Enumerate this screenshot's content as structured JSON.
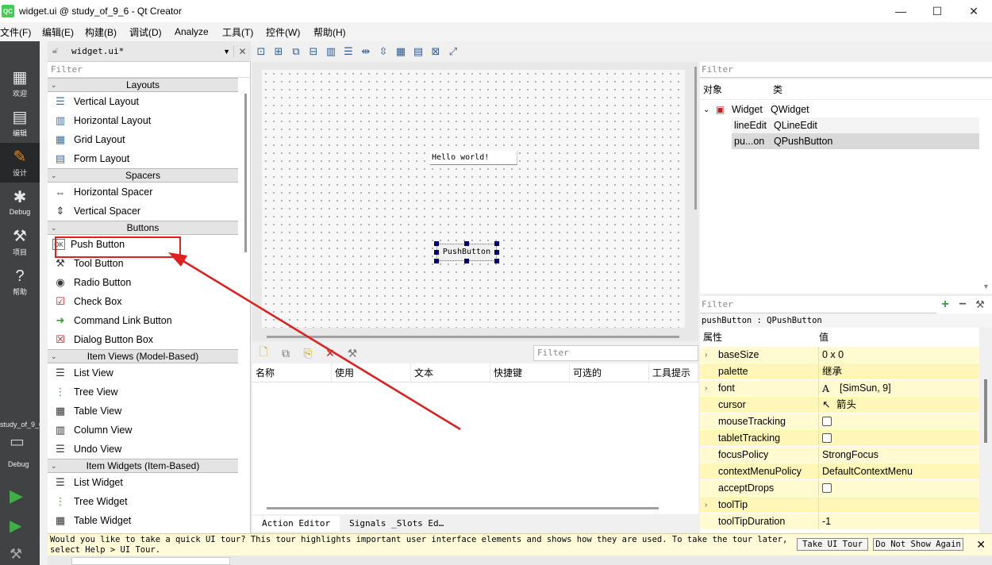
{
  "window": {
    "title": "widget.ui @ study_of_9_6 - Qt Creator",
    "app_icon_text": "QC",
    "controls": [
      "—",
      "☐",
      "✕"
    ]
  },
  "menubar": [
    "文件(F)",
    "编辑(E)",
    "构建(B)",
    "调试(D)",
    "Analyze",
    "工具(T)",
    "控件(W)",
    "帮助(H)"
  ],
  "modes": [
    {
      "label": "欢迎",
      "icon": "grid-icon"
    },
    {
      "label": "编辑",
      "icon": "document-icon"
    },
    {
      "label": "设计",
      "icon": "pencil-icon"
    },
    {
      "label": "Debug",
      "icon": "bug-icon"
    },
    {
      "label": "项目",
      "icon": "wrench-icon"
    },
    {
      "label": "帮助",
      "icon": "help-icon"
    }
  ],
  "session": {
    "project": "study_of_9_6",
    "kit": "Debug"
  },
  "editor": {
    "file": "widget.ui*"
  },
  "toolbox": {
    "filter_placeholder": "Filter",
    "categories": [
      {
        "name": "Layouts",
        "items": [
          "Vertical Layout",
          "Horizontal Layout",
          "Grid Layout",
          "Form Layout"
        ]
      },
      {
        "name": "Spacers",
        "items": [
          "Horizontal Spacer",
          "Vertical Spacer"
        ]
      },
      {
        "name": "Buttons",
        "items": [
          "Push Button",
          "Tool Button",
          "Radio Button",
          "Check Box",
          "Command Link Button",
          "Dialog Button Box"
        ]
      },
      {
        "name": "Item Views (Model-Based)",
        "items": [
          "List View",
          "Tree View",
          "Table View",
          "Column View",
          "Undo View"
        ]
      },
      {
        "name": "Item Widgets (Item-Based)",
        "items": [
          "List Widget",
          "Tree Widget",
          "Table Widget"
        ]
      }
    ]
  },
  "form": {
    "lineedit_text": "Hello world!",
    "pushbutton_text": "PushButton"
  },
  "action_editor": {
    "filter_placeholder": "Filter",
    "columns": [
      "名称",
      "使用",
      "文本",
      "快捷键",
      "可选的",
      "工具提示"
    ],
    "tabs": [
      "Action Editor",
      "Signals _Slots Ed…"
    ]
  },
  "object_inspector": {
    "filter_placeholder": "Filter",
    "columns": [
      "对象",
      "类"
    ],
    "rows": [
      {
        "object": "Widget",
        "class": "QWidget"
      },
      {
        "object": "lineEdit",
        "class": "QLineEdit"
      },
      {
        "object": "pu...on",
        "class": "QPushButton"
      }
    ]
  },
  "property_editor": {
    "filter_placeholder": "Filter",
    "title": "pushButton : QPushButton",
    "columns": [
      "属性",
      "值"
    ],
    "rows": [
      {
        "name": "baseSize",
        "value": "0 x 0",
        "expandable": true
      },
      {
        "name": "palette",
        "value": "继承",
        "expandable": false
      },
      {
        "name": "font",
        "value": "[SimSun, 9]",
        "expandable": true,
        "icon": "A"
      },
      {
        "name": "cursor",
        "value": "箭头",
        "expandable": false
      },
      {
        "name": "mouseTracking",
        "value": "",
        "checkbox": true
      },
      {
        "name": "tabletTracking",
        "value": "",
        "checkbox": true
      },
      {
        "name": "focusPolicy",
        "value": "StrongFocus"
      },
      {
        "name": "contextMenuPolicy",
        "value": "DefaultContextMenu"
      },
      {
        "name": "acceptDrops",
        "value": "",
        "checkbox": true
      },
      {
        "name": "toolTip",
        "value": "",
        "expandable": true
      },
      {
        "name": "toolTipDuration",
        "value": "-1"
      }
    ]
  },
  "infobar": {
    "message": "Would you like to take a quick UI tour? This tour highlights important user interface elements and shows how they are used. To take the tour later, select Help > UI Tour.",
    "take_tour": "Take UI Tour",
    "dont_show": "Do Not Show Again",
    "close": "✕"
  },
  "colors": {
    "annotation": "#e02020",
    "mode_bar": "#404244",
    "active_mode": "#f08a1c"
  }
}
